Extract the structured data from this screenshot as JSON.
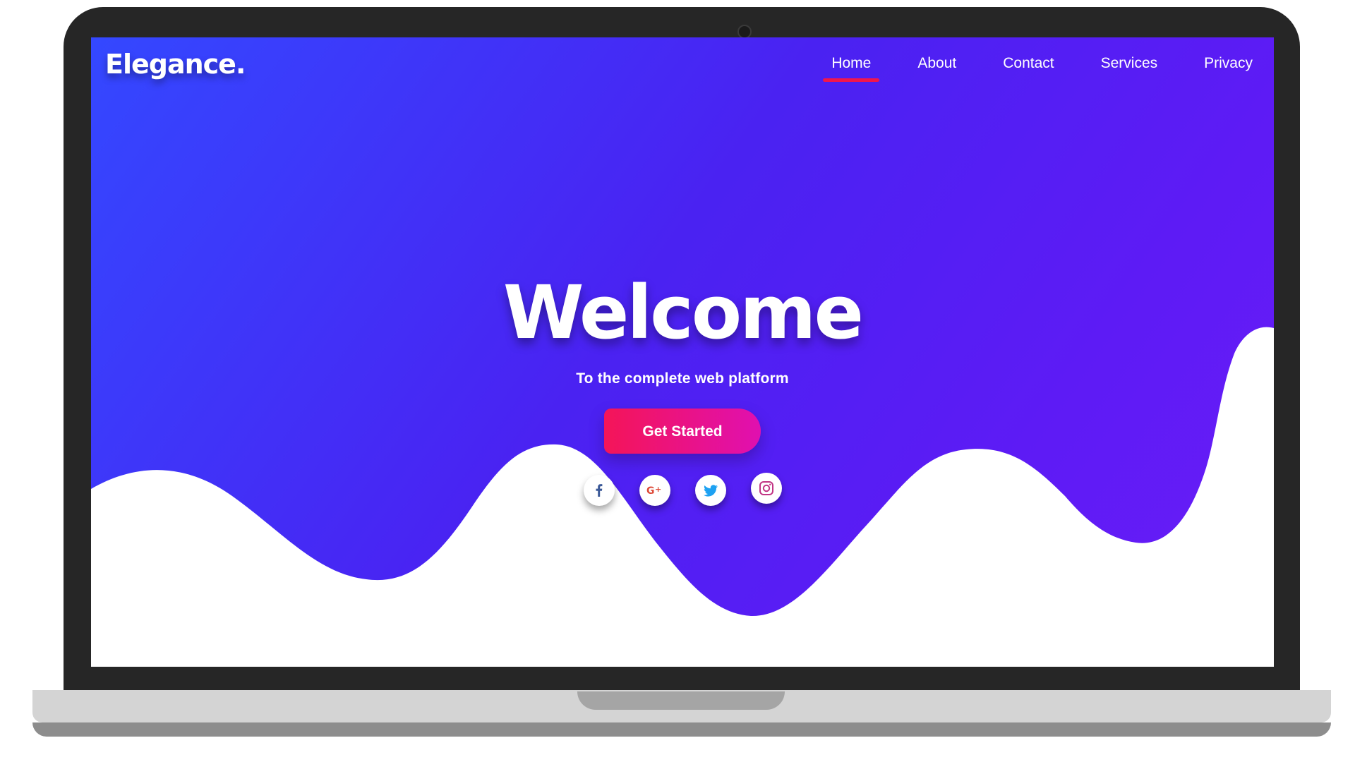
{
  "brand": {
    "logo_text": "Elegance."
  },
  "nav": {
    "items": [
      {
        "label": "Home",
        "active": true
      },
      {
        "label": "About",
        "active": false
      },
      {
        "label": "Contact",
        "active": false
      },
      {
        "label": "Services",
        "active": false
      },
      {
        "label": "Privacy",
        "active": false
      }
    ]
  },
  "hero": {
    "title": "Welcome",
    "subtitle": "To the complete web platform",
    "cta_label": "Get Started"
  },
  "social": [
    {
      "icon": "facebook-icon",
      "glyph": "f",
      "color": "#3b5998"
    },
    {
      "icon": "google-plus-icon",
      "glyph": "G+",
      "color": "#dd4b39"
    },
    {
      "icon": "twitter-icon",
      "glyph": "bird",
      "color": "#1da1f2"
    },
    {
      "icon": "instagram-icon",
      "glyph": "camera",
      "color": "#c13584"
    }
  ],
  "colors": {
    "gradient_start": "#3448ff",
    "gradient_end": "#6a1cf8",
    "accent_underline": "#f0164d",
    "button_start": "#f41558",
    "button_end": "#e010b0",
    "bezel": "#262626"
  }
}
